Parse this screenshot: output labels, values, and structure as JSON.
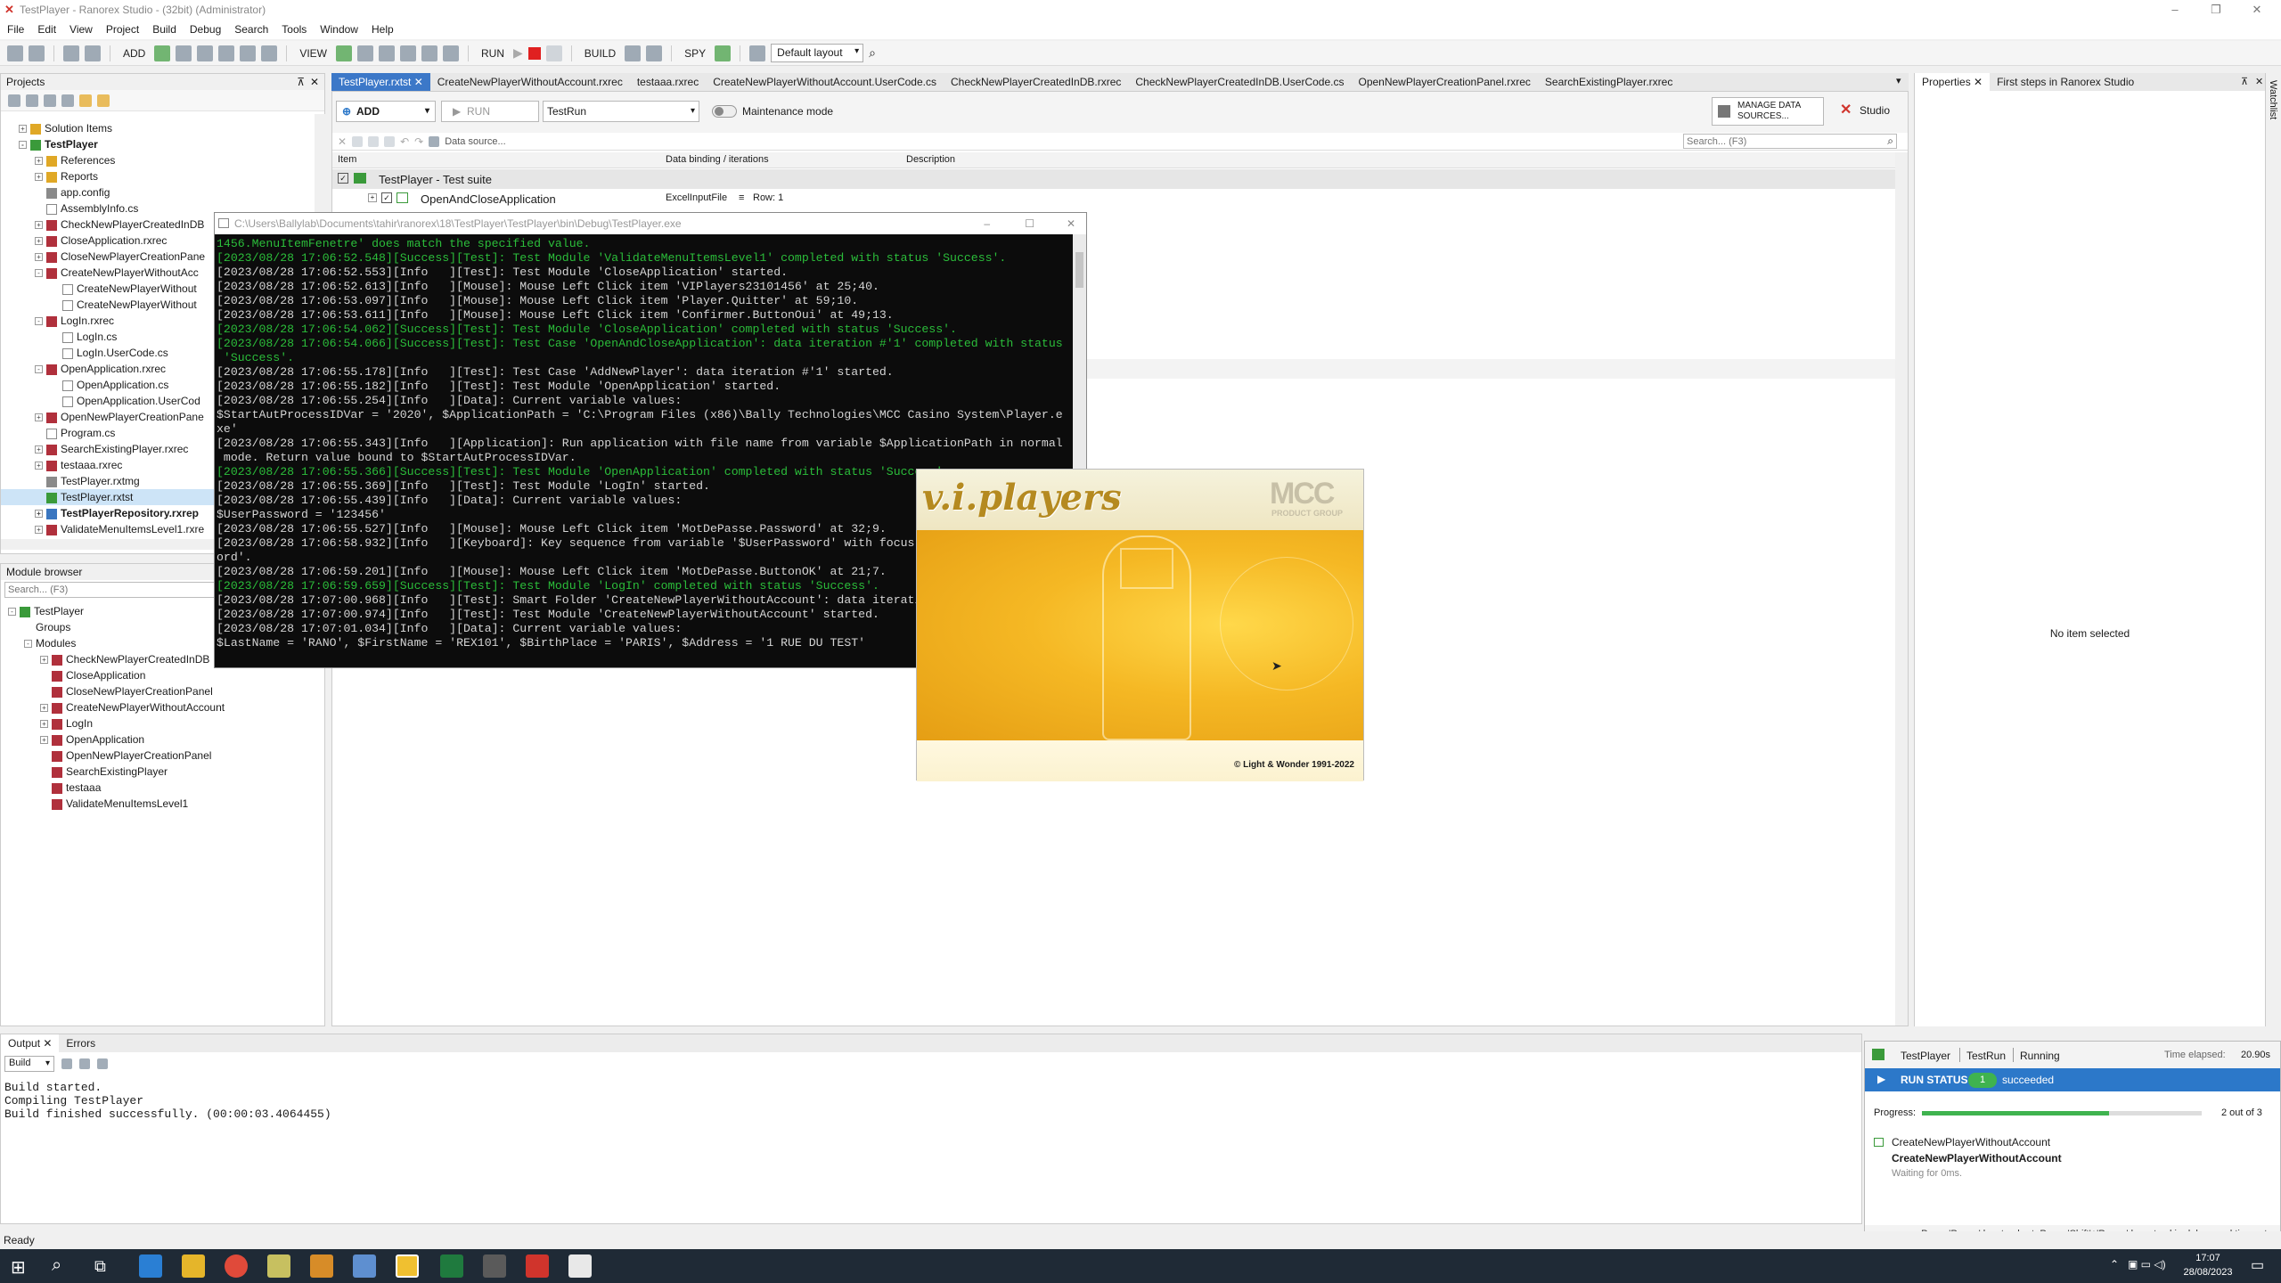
{
  "window": {
    "title": "TestPlayer - Ranorex Studio - (32bit) (Administrator)"
  },
  "menu": [
    "File",
    "Edit",
    "View",
    "Project",
    "Build",
    "Debug",
    "Search",
    "Tools",
    "Window",
    "Help"
  ],
  "toolbar": {
    "add": "ADD",
    "view": "VIEW",
    "run": "RUN",
    "build": "BUILD",
    "spy": "SPY",
    "layout": "Default layout"
  },
  "projects": {
    "title": "Projects",
    "tree": [
      {
        "label": "Solution Items",
        "indent": 1,
        "toggle": "+",
        "icon": "folder"
      },
      {
        "label": "TestPlayer",
        "indent": 1,
        "toggle": "-",
        "icon": "project",
        "bold": true
      },
      {
        "label": "References",
        "indent": 2,
        "toggle": "+",
        "icon": "folder"
      },
      {
        "label": "Reports",
        "indent": 2,
        "toggle": "+",
        "icon": "folder"
      },
      {
        "label": "app.config",
        "indent": 2,
        "icon": "file"
      },
      {
        "label": "AssemblyInfo.cs",
        "indent": 2,
        "icon": "cs"
      },
      {
        "label": "CheckNewPlayerCreatedInDB",
        "indent": 2,
        "toggle": "+",
        "icon": "module"
      },
      {
        "label": "CloseApplication.rxrec",
        "indent": 2,
        "toggle": "+",
        "icon": "module"
      },
      {
        "label": "CloseNewPlayerCreationPane",
        "indent": 2,
        "toggle": "+",
        "icon": "module"
      },
      {
        "label": "CreateNewPlayerWithoutAcc",
        "indent": 2,
        "toggle": "-",
        "icon": "module"
      },
      {
        "label": "CreateNewPlayerWithout",
        "indent": 3,
        "icon": "cs"
      },
      {
        "label": "CreateNewPlayerWithout",
        "indent": 3,
        "icon": "cs"
      },
      {
        "label": "LogIn.rxrec",
        "indent": 2,
        "toggle": "-",
        "icon": "module"
      },
      {
        "label": "LogIn.cs",
        "indent": 3,
        "icon": "cs"
      },
      {
        "label": "LogIn.UserCode.cs",
        "indent": 3,
        "icon": "cs"
      },
      {
        "label": "OpenApplication.rxrec",
        "indent": 2,
        "toggle": "-",
        "icon": "module"
      },
      {
        "label": "OpenApplication.cs",
        "indent": 3,
        "icon": "cs"
      },
      {
        "label": "OpenApplication.UserCod",
        "indent": 3,
        "icon": "cs"
      },
      {
        "label": "OpenNewPlayerCreationPane",
        "indent": 2,
        "toggle": "+",
        "icon": "module"
      },
      {
        "label": "Program.cs",
        "indent": 2,
        "icon": "cs"
      },
      {
        "label": "SearchExistingPlayer.rxrec",
        "indent": 2,
        "toggle": "+",
        "icon": "module"
      },
      {
        "label": "testaaa.rxrec",
        "indent": 2,
        "toggle": "+",
        "icon": "module"
      },
      {
        "label": "TestPlayer.rxtmg",
        "indent": 2,
        "icon": "file"
      },
      {
        "label": "TestPlayer.rxtst",
        "indent": 2,
        "icon": "suite",
        "selected": true
      },
      {
        "label": "TestPlayerRepository.rxrep",
        "indent": 2,
        "toggle": "+",
        "icon": "repo",
        "bold": true
      },
      {
        "label": "ValidateMenuItemsLevel1.rxre",
        "indent": 2,
        "toggle": "+",
        "icon": "module"
      }
    ]
  },
  "modulebrowser": {
    "title": "Module browser",
    "search_placeholder": "Search... (F3)",
    "tree": [
      {
        "label": "TestPlayer",
        "indent": 0,
        "toggle": "-",
        "icon": "project"
      },
      {
        "label": "Groups",
        "indent": 1,
        "icon": "none"
      },
      {
        "label": "Modules",
        "indent": 1,
        "toggle": "-",
        "icon": "none"
      },
      {
        "label": "CheckNewPlayerCreatedInDB",
        "indent": 2,
        "toggle": "+",
        "icon": "module"
      },
      {
        "label": "CloseApplication",
        "indent": 2,
        "icon": "module"
      },
      {
        "label": "CloseNewPlayerCreationPanel",
        "indent": 2,
        "icon": "module"
      },
      {
        "label": "CreateNewPlayerWithoutAccount",
        "indent": 2,
        "toggle": "+",
        "icon": "module"
      },
      {
        "label": "LogIn",
        "indent": 2,
        "toggle": "+",
        "icon": "module"
      },
      {
        "label": "OpenApplication",
        "indent": 2,
        "toggle": "+",
        "icon": "module"
      },
      {
        "label": "OpenNewPlayerCreationPanel",
        "indent": 2,
        "icon": "module"
      },
      {
        "label": "SearchExistingPlayer",
        "indent": 2,
        "icon": "module"
      },
      {
        "label": "testaaa",
        "indent": 2,
        "icon": "module"
      },
      {
        "label": "ValidateMenuItemsLevel1",
        "indent": 2,
        "icon": "module"
      }
    ]
  },
  "doctabs": [
    "TestPlayer.rxtst",
    "CreateNewPlayerWithoutAccount.rxrec",
    "testaaa.rxrec",
    "CreateNewPlayerWithoutAccount.UserCode.cs",
    "CheckNewPlayerCreatedInDB.rxrec",
    "CheckNewPlayerCreatedInDB.UserCode.cs",
    "OpenNewPlayerCreationPanel.rxrec",
    "SearchExistingPlayer.rxrec"
  ],
  "editor": {
    "add": "ADD",
    "run": "RUN",
    "runconfig": "TestRun",
    "maintenance": "Maintenance mode",
    "manage_ds": "MANAGE DATA SOURCES...",
    "studio": "Studio",
    "datasource": "Data source...",
    "search_placeholder": "Search... (F3)",
    "col_item": "Item",
    "col_binding": "Data binding / iterations",
    "col_desc": "Description",
    "suite_label": "TestPlayer - Test suite",
    "case_label": "OpenAndCloseApplication",
    "case_binding": "ExcelInputFile",
    "case_row": "Row: 1"
  },
  "rightpanel": {
    "tab1": "Properties",
    "tab2": "First steps in Ranorex Studio",
    "empty": "No item selected",
    "side": "Watchlist"
  },
  "console": {
    "title": "C:\\Users\\Ballylab\\Documents\\tahir\\ranorex\\18\\TestPlayer\\TestPlayer\\bin\\Debug\\TestPlayer.exe",
    "lines": [
      {
        "t": "1456.MenuItemFenetre' does match the specified value.",
        "c": "s"
      },
      {
        "t": "[2023/08/28 17:06:52.548][Success][Test]: Test Module 'ValidateMenuItemsLevel1' completed with status 'Success'.",
        "c": "s"
      },
      {
        "t": "[2023/08/28 17:06:52.553][Info   ][Test]: Test Module 'CloseApplication' started.",
        "c": "i"
      },
      {
        "t": "[2023/08/28 17:06:52.613][Info   ][Mouse]: Mouse Left Click item 'VIPlayers23101456' at 25;40.",
        "c": "i"
      },
      {
        "t": "[2023/08/28 17:06:53.097][Info   ][Mouse]: Mouse Left Click item 'Player.Quitter' at 59;10.",
        "c": "i"
      },
      {
        "t": "[2023/08/28 17:06:53.611][Info   ][Mouse]: Mouse Left Click item 'Confirmer.ButtonOui' at 49;13.",
        "c": "i"
      },
      {
        "t": "[2023/08/28 17:06:54.062][Success][Test]: Test Module 'CloseApplication' completed with status 'Success'.",
        "c": "s"
      },
      {
        "t": "[2023/08/28 17:06:54.066][Success][Test]: Test Case 'OpenAndCloseApplication': data iteration #'1' completed with status",
        "c": "s"
      },
      {
        "t": " 'Success'.",
        "c": "s"
      },
      {
        "t": "[2023/08/28 17:06:55.178][Info   ][Test]: Test Case 'AddNewPlayer': data iteration #'1' started.",
        "c": "i"
      },
      {
        "t": "[2023/08/28 17:06:55.182][Info   ][Test]: Test Module 'OpenApplication' started.",
        "c": "i"
      },
      {
        "t": "[2023/08/28 17:06:55.254][Info   ][Data]: Current variable values:",
        "c": "i"
      },
      {
        "t": "$StartAutProcessIDVar = '2020', $ApplicationPath = 'C:\\Program Files (x86)\\Bally Technologies\\MCC Casino System\\Player.e",
        "c": "i"
      },
      {
        "t": "xe'",
        "c": "i"
      },
      {
        "t": "[2023/08/28 17:06:55.343][Info   ][Application]: Run application with file name from variable $ApplicationPath in normal",
        "c": "i"
      },
      {
        "t": " mode. Return value bound to $StartAutProcessIDVar.",
        "c": "i"
      },
      {
        "t": "[2023/08/28 17:06:55.366][Success][Test]: Test Module 'OpenApplication' completed with status 'Success'.",
        "c": "s"
      },
      {
        "t": "[2023/08/28 17:06:55.369][Info   ][Test]: Test Module 'LogIn' started.",
        "c": "i"
      },
      {
        "t": "[2023/08/28 17:06:55.439][Info   ][Data]: Current variable values:",
        "c": "i"
      },
      {
        "t": "$UserPassword = '123456'",
        "c": "i"
      },
      {
        "t": "[2023/08/28 17:06:55.527][Info   ][Mouse]: Mouse Left Click item 'MotDePasse.Password' at 32;9.",
        "c": "i"
      },
      {
        "t": "[2023/08/28 17:06:58.932][Info   ][Keyboard]: Key sequence from variable '$UserPassword' with focus on 'MotDePasse.Passw",
        "c": "i"
      },
      {
        "t": "ord'.",
        "c": "i"
      },
      {
        "t": "[2023/08/28 17:06:59.201][Info   ][Mouse]: Mouse Left Click item 'MotDePasse.ButtonOK' at 21;7.",
        "c": "i"
      },
      {
        "t": "[2023/08/28 17:06:59.659][Success][Test]: Test Module 'LogIn' completed with status 'Success'.",
        "c": "s"
      },
      {
        "t": "[2023/08/28 17:07:00.968][Info   ][Test]: Smart Folder 'CreateNewPlayerWithoutAccount': data iteration #'1' started.",
        "c": "i"
      },
      {
        "t": "[2023/08/28 17:07:00.974][Info   ][Test]: Test Module 'CreateNewPlayerWithoutAccount' started.",
        "c": "i"
      },
      {
        "t": "[2023/08/28 17:07:01.034][Info   ][Data]: Current variable values:",
        "c": "i"
      },
      {
        "t": "$LastName = 'RANO', $FirstName = 'REX101', $BirthPlace = 'PARIS', $Address = '1 RUE DU TEST'",
        "c": "i"
      }
    ]
  },
  "splash": {
    "logo": "v.i.players",
    "brand": "MCC",
    "brand_sub": "PRODUCT GROUP",
    "copyright": "© Light & Wonder 1991-2022"
  },
  "output": {
    "tab1": "Output",
    "tab2": "Errors",
    "filter": "Build",
    "lines": [
      "Build started.",
      "Compiling TestPlayer",
      "Build finished successfully. (00:00:03.4064455)"
    ]
  },
  "runstatus": {
    "project": "TestPlayer",
    "config": "TestRun",
    "state": "Running",
    "elapsed_label": "Time elapsed:",
    "elapsed": "20.90s",
    "status_label": "RUN STATUS",
    "succeeded_count": "1",
    "succeeded": "succeeded",
    "progress_label": "Progress:",
    "progress": "2 out of 3",
    "progress_fraction": 0.67,
    "item1": "CreateNewPlayerWithoutAccount",
    "item2": "CreateNewPlayerWithoutAccount",
    "waiting": "Waiting for 0ms.",
    "hint": "Press 'Pause' key to abort. Press 'Shift'+'Pause' keys to skip delays and timeouts."
  },
  "statusbar": {
    "text": "Ready"
  },
  "taskbar": {
    "time": "17:07",
    "date": "28/08/2023"
  },
  "colors": {
    "accent": "#3c78c8",
    "success": "#2bbd3a",
    "runbar": "#2c78c9"
  }
}
